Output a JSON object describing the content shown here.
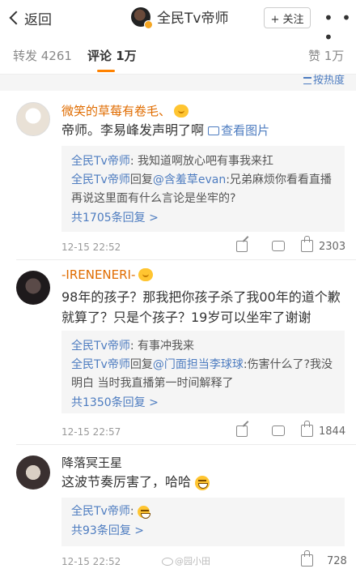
{
  "header": {
    "back_label": "返回",
    "title": "全民Tv帝师",
    "follow_label": "+ 关注",
    "more_glyph": "• • •"
  },
  "tabs": {
    "reposts": "转发 4261",
    "comments": "评论 1万",
    "likes": "赞 1万"
  },
  "sort_label": "按热度",
  "comments": [
    {
      "name": "微笑的草莓有卷毛、",
      "text": "帝师。李易峰发声明了啊",
      "image_link": "查看图片",
      "replies": [
        {
          "who": "全民Tv帝师",
          "sep": ": ",
          "text": "我知道啊放心吧有事我来扛"
        },
        {
          "who": "全民Tv帝师",
          "mid": "回复",
          "at": "@含羞草evan",
          "sep": ":",
          "text": "兄弟麻烦你看看直播再说这里面有什么言论是坐牢的?"
        }
      ],
      "reply_count": "共1705条回复 >",
      "time": "12-15 22:52",
      "likes": "2303"
    },
    {
      "name": "-IRENENERI-",
      "text": "98年的孩子？那我把你孩子杀了我00年的道个歉就算了？只是个孩子？19岁可以坐牢了谢谢",
      "replies": [
        {
          "who": "全民Tv帝师",
          "sep": ": ",
          "text": "有事冲我来"
        },
        {
          "who": "全民Tv帝师",
          "mid": "回复",
          "at": "@门面担当李球球",
          "sep": ":",
          "text": "伤害什么了?我没明白 当时我直播第一时间解释了"
        }
      ],
      "reply_count": "共1350条回复 >",
      "time": "12-15 22:57",
      "likes": "1844"
    },
    {
      "name": "降落冥王星",
      "text": "这波节奏厉害了，哈哈",
      "replies": [
        {
          "who": "全民Tv帝师",
          "sep": ": ",
          "text": ""
        }
      ],
      "reply_count": "共93条回复 >",
      "time": "12-15 22:52",
      "likes": "728"
    }
  ],
  "watermark": "@园小田",
  "colors": {
    "link": "#4d7cc0",
    "accent": "#ff8200",
    "name_orange": "#e06c00"
  }
}
